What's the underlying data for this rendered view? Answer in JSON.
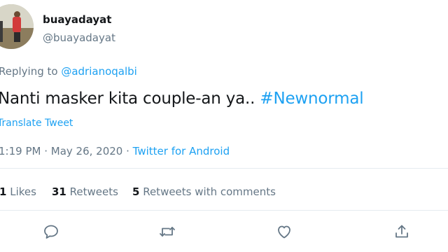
{
  "user": {
    "display_name": "buayadayat",
    "handle": "@buayadayat"
  },
  "reply": {
    "prefix": "Replying to ",
    "mention": "@adrianoqalbi"
  },
  "tweet": {
    "text": "Nanti masker kita couple-an ya.. ",
    "hashtag": "#Newnormal"
  },
  "translate_label": "Translate Tweet",
  "meta": {
    "time": "1:19 PM",
    "separator1": " · ",
    "date": "May 26, 2020",
    "separator2": " · ",
    "source": "Twitter for Android"
  },
  "stats": {
    "likes_count": "1",
    "likes_label": " Likes",
    "retweets_count": "31",
    "retweets_label": " Retweets",
    "quotes_count": "5",
    "quotes_label": " Retweets with comments"
  },
  "actions": {
    "reply_icon": "reply-icon",
    "retweet_icon": "retweet-icon",
    "like_icon": "like-icon",
    "share_icon": "share-icon"
  },
  "colors": {
    "accent": "#1da1f2",
    "muted": "#657786",
    "text": "#14171a",
    "divider": "#e6ecf0"
  }
}
